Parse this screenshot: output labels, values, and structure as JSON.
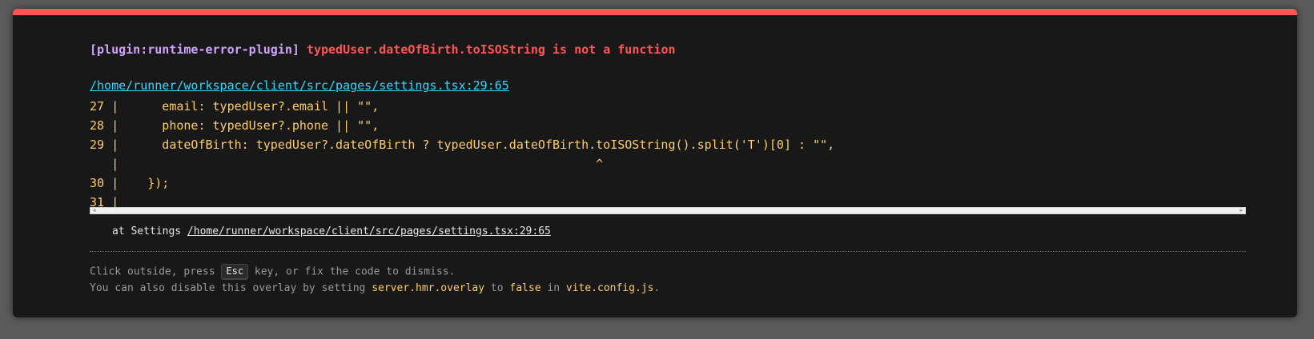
{
  "error": {
    "plugin": "[plugin:runtime-error-plugin]",
    "message": "typedUser.dateOfBirth.toISOString is not a function",
    "file": "/home/runner/workspace/client/src/pages/settings.tsx:29:65"
  },
  "frame": {
    "lines": [
      "27 |      email: typedUser?.email || \"\",",
      "28 |      phone: typedUser?.phone || \"\",",
      "29 |      dateOfBirth: typedUser?.dateOfBirth ? typedUser.dateOfBirth.toISOString().split('T')[0] : \"\",",
      "   |                                                                  ^",
      "30 |    });",
      "31 |"
    ]
  },
  "stack": {
    "prefix": "at Settings ",
    "link": "/home/runner/workspace/client/src/pages/settings.tsx:29:65"
  },
  "tip": {
    "line1_before": "Click outside, press ",
    "esc_key": "Esc",
    "line1_after": " key, or fix the code to dismiss.",
    "line2_before": "You can also disable this overlay by setting ",
    "config_key": "server.hmr.overlay",
    "line2_middle": " to ",
    "false_value": "false",
    "line2_in": " in ",
    "config_file": "vite.config.js",
    "line2_end": "."
  },
  "colors": {
    "accent_red": "#ff5555",
    "plugin_purple": "#cfa4ff",
    "link_cyan": "#2dd9fe",
    "code_yellow": "#ffcc66",
    "window_bg": "#181818"
  },
  "icons": {
    "scroll_left": "triangle-left",
    "scroll_right": "triangle-right"
  }
}
